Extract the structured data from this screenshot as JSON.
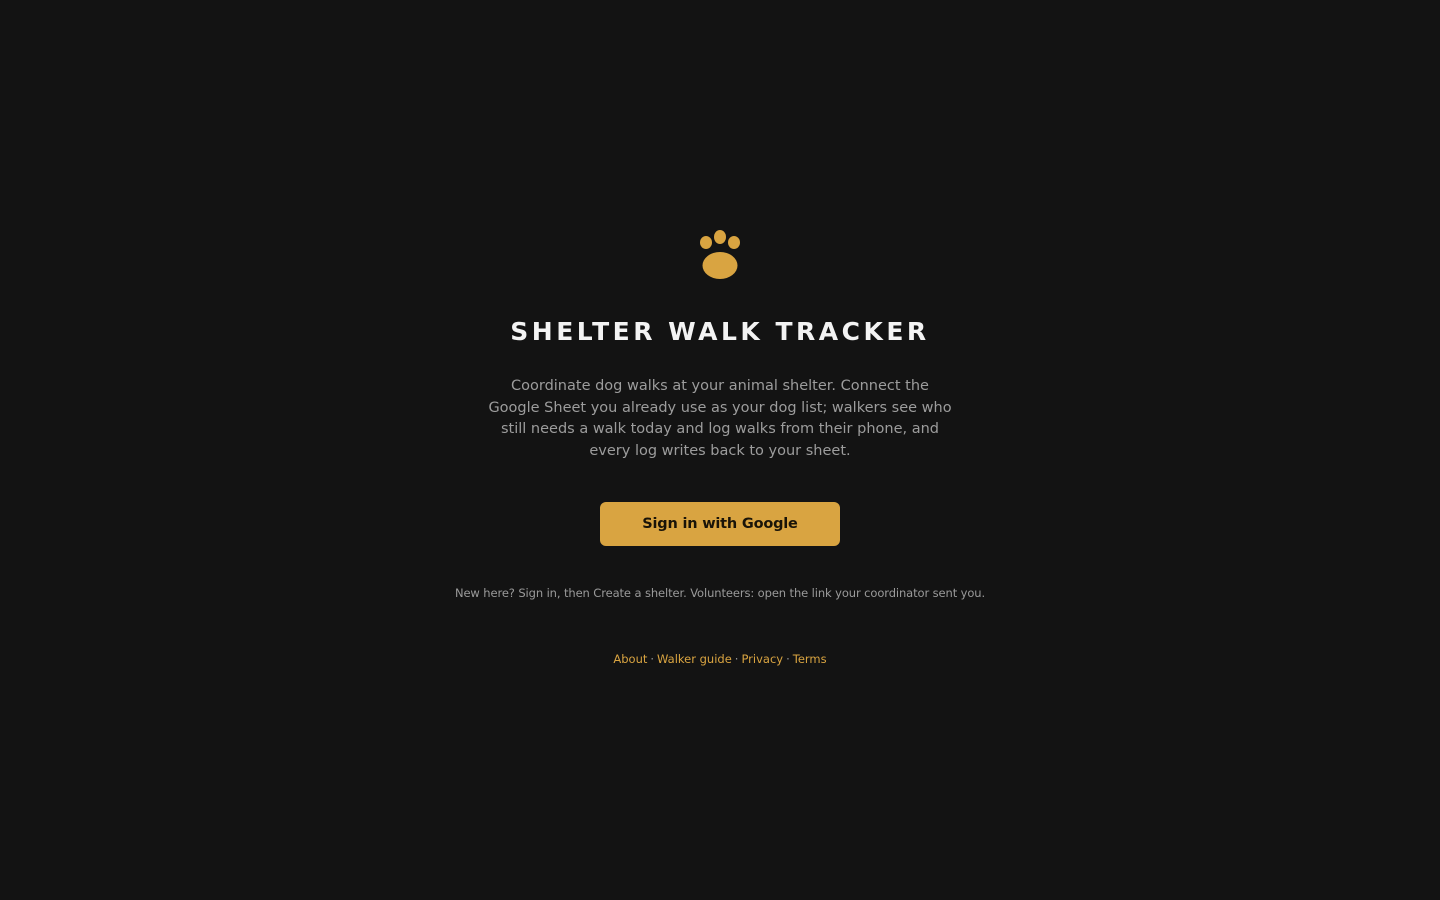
{
  "app": {
    "title": "SHELTER WALK TRACKER",
    "logo_icon": "paw-icon",
    "accent_color": "#d9a441",
    "background_color": "#131313"
  },
  "intro": {
    "description": "Coordinate dog walks at your animal shelter. Connect the Google Sheet you already use as your dog list; walkers see who still needs a walk today and log walks from their phone, and every log writes back to your sheet."
  },
  "auth": {
    "signin_label": "Sign in with Google"
  },
  "help": {
    "text": "New here? Sign in, then Create a shelter. Volunteers: open the link your coordinator sent you."
  },
  "footer": {
    "links": [
      {
        "label": "About"
      },
      {
        "label": "Walker guide"
      },
      {
        "label": "Privacy"
      },
      {
        "label": "Terms"
      }
    ],
    "separator": "·"
  }
}
